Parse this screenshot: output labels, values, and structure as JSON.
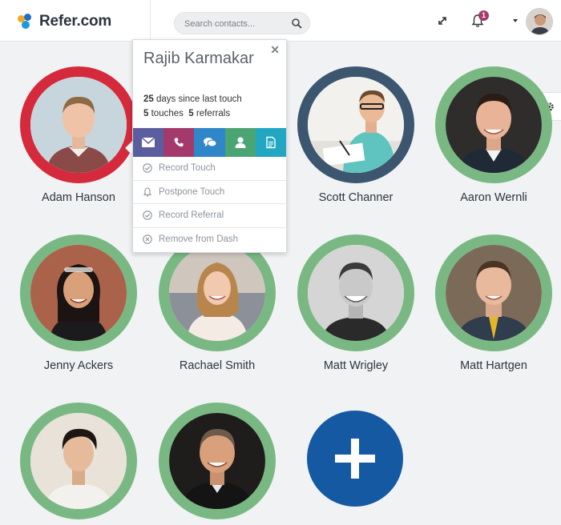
{
  "app": {
    "brand": "Refer.com"
  },
  "search": {
    "placeholder": "Search contacts..."
  },
  "header": {
    "notification_count": "1"
  },
  "popup": {
    "name": "Rajib Karmakar",
    "days": "25",
    "days_text": "days since last touch",
    "touches": "5",
    "touches_text": "touches",
    "referrals": "5",
    "referrals_text": "referrals",
    "close_glyph": "✕",
    "actions": [
      {
        "icon": "envelope-icon",
        "color": "#5b5e9e"
      },
      {
        "icon": "phone-icon",
        "color": "#a33a6b"
      },
      {
        "icon": "chat-icon",
        "color": "#2f86c8"
      },
      {
        "icon": "person-icon",
        "color": "#4aa573"
      },
      {
        "icon": "document-icon",
        "color": "#21a7c2"
      }
    ],
    "menu": [
      {
        "label": "Record Touch",
        "icon": "check-circle-icon"
      },
      {
        "label": "Postpone Touch",
        "icon": "bell-icon"
      },
      {
        "label": "Record Referral",
        "icon": "check-circle-icon"
      },
      {
        "label": "Remove from Dash",
        "icon": "close-circle-icon"
      }
    ]
  },
  "contacts": [
    {
      "name": "Adam Hanson",
      "ring": "#d42a3c"
    },
    {
      "name": "",
      "ring": "#79b883"
    },
    {
      "name": "Scott Channer",
      "ring": "#3d5670"
    },
    {
      "name": "Aaron Wernli",
      "ring": "#79b883"
    },
    {
      "name": "Jenny Ackers",
      "ring": "#79b883"
    },
    {
      "name": "Rachael Smith",
      "ring": "#79b883"
    },
    {
      "name": "Matt Wrigley",
      "ring": "#79b883"
    },
    {
      "name": "Matt Hartgen",
      "ring": "#79b883"
    },
    {
      "name": "",
      "ring": "#79b883"
    },
    {
      "name": "",
      "ring": "#79b883"
    }
  ],
  "colors": {
    "accent": "#1559a3",
    "ring_default": "#79b883"
  }
}
